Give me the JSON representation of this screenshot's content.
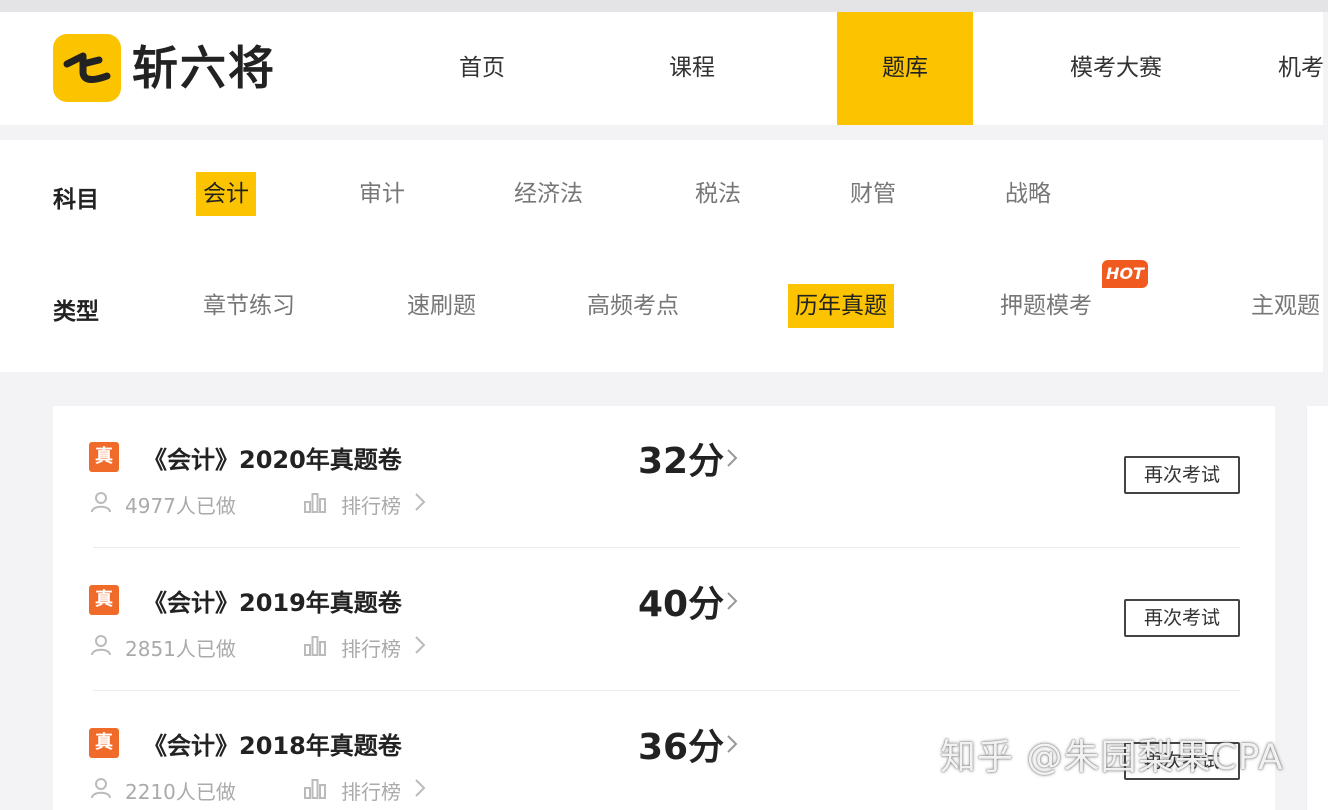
{
  "brand": {
    "name": "斩六将"
  },
  "nav": {
    "items": [
      {
        "label": "首页"
      },
      {
        "label": "课程"
      },
      {
        "label": "题库"
      },
      {
        "label": "模考大赛"
      },
      {
        "label": "机考"
      }
    ],
    "active_index": 2
  },
  "filters": {
    "subject": {
      "label": "科目",
      "options": [
        "会计",
        "审计",
        "经济法",
        "税法",
        "财管",
        "战略"
      ],
      "selected": "会计"
    },
    "type": {
      "label": "类型",
      "options": [
        "章节练习",
        "速刷题",
        "高频考点",
        "历年真题",
        "押题模考",
        "主观题"
      ],
      "selected": "历年真题",
      "hot_badge": "HOT"
    }
  },
  "papers": [
    {
      "tag": "真",
      "title": "《会计》2020年真题卷",
      "done_count": "4977人已做",
      "ranking": "排行榜",
      "score": "32分",
      "action": "再次考试"
    },
    {
      "tag": "真",
      "title": "《会计》2019年真题卷",
      "done_count": "2851人已做",
      "ranking": "排行榜",
      "score": "40分",
      "action": "再次考试"
    },
    {
      "tag": "真",
      "title": "《会计》2018年真题卷",
      "done_count": "2210人已做",
      "ranking": "排行榜",
      "score": "36分",
      "action": "再次考试"
    }
  ],
  "watermark": "知乎 @朱园梨果CPA",
  "colors": {
    "accent": "#fcc400",
    "tag": "#f06a2a",
    "hot": "#f05a1e"
  }
}
